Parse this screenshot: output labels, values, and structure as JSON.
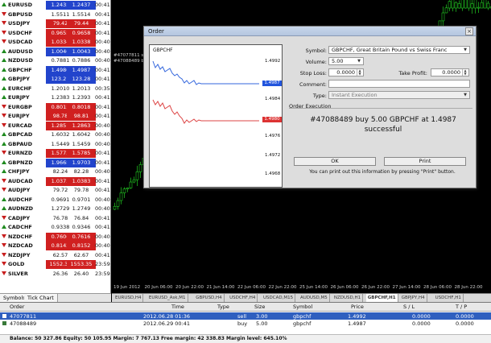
{
  "market_watch": {
    "rows": [
      {
        "symbol": "EURUSD",
        "bid": "1.2435",
        "ask": "1.2437",
        "time": "00:41",
        "dir": "up",
        "style": "blue"
      },
      {
        "symbol": "GBPUSD",
        "bid": "1.5511",
        "ask": "1.5514",
        "time": "00:41",
        "dir": "dn",
        "style": "plain"
      },
      {
        "symbol": "USDJPY",
        "bid": "79.42",
        "ask": "79.44",
        "time": "00:41",
        "dir": "dn",
        "style": "red"
      },
      {
        "symbol": "USDCHF",
        "bid": "0.9655",
        "ask": "0.9658",
        "time": "00:41",
        "dir": "dn",
        "style": "red"
      },
      {
        "symbol": "USDCAD",
        "bid": "1.0334",
        "ask": "1.0338",
        "time": "00:40",
        "dir": "dn",
        "style": "red"
      },
      {
        "symbol": "AUDUSD",
        "bid": "1.0040",
        "ask": "1.0043",
        "time": "00:40",
        "dir": "up",
        "style": "blue"
      },
      {
        "symbol": "NZDUSD",
        "bid": "0.7881",
        "ask": "0.7886",
        "time": "00:40",
        "dir": "up",
        "style": "plain"
      },
      {
        "symbol": "GBPCHF",
        "bid": "1.4980",
        "ask": "1.4987",
        "time": "00:41",
        "dir": "up",
        "style": "blue"
      },
      {
        "symbol": "GBPJPY",
        "bid": "123.21",
        "ask": "123.28",
        "time": "00:41",
        "dir": "up",
        "style": "blue"
      },
      {
        "symbol": "EURCHF",
        "bid": "1.2010",
        "ask": "1.2013",
        "time": "00:35",
        "dir": "up",
        "style": "plain"
      },
      {
        "symbol": "EURJPY",
        "bid": "1.2383",
        "ask": "1.2393",
        "time": "00:41",
        "dir": "up",
        "style": "plain"
      },
      {
        "symbol": "EURGBP",
        "bid": "0.8015",
        "ask": "0.8018",
        "time": "00:41",
        "dir": "dn",
        "style": "red"
      },
      {
        "symbol": "EURJPY",
        "bid": "98.78",
        "ask": "98.81",
        "time": "00:41",
        "dir": "dn",
        "style": "red"
      },
      {
        "symbol": "EURCAD",
        "bid": "1.2851",
        "ask": "1.2863",
        "time": "00:40",
        "dir": "dn",
        "style": "red"
      },
      {
        "symbol": "GBPCAD",
        "bid": "1.6032",
        "ask": "1.6042",
        "time": "00:40",
        "dir": "up",
        "style": "plain"
      },
      {
        "symbol": "GBPAUD",
        "bid": "1.5449",
        "ask": "1.5459",
        "time": "00:40",
        "dir": "up",
        "style": "plain"
      },
      {
        "symbol": "EURNZD",
        "bid": "1.5773",
        "ask": "1.5785",
        "time": "00:41",
        "dir": "dn",
        "style": "red"
      },
      {
        "symbol": "GBPNZD",
        "bid": "1.9668",
        "ask": "1.9703",
        "time": "00:41",
        "dir": "up",
        "style": "blue"
      },
      {
        "symbol": "CHFJPY",
        "bid": "82.24",
        "ask": "82.28",
        "time": "00:40",
        "dir": "up",
        "style": "plain"
      },
      {
        "symbol": "AUDCAD",
        "bid": "1.0373",
        "ask": "1.0383",
        "time": "00:41",
        "dir": "dn",
        "style": "red"
      },
      {
        "symbol": "AUDJPY",
        "bid": "79.72",
        "ask": "79.78",
        "time": "00:41",
        "dir": "dn",
        "style": "plain"
      },
      {
        "symbol": "AUDCHF",
        "bid": "0.9691",
        "ask": "0.9701",
        "time": "00:40",
        "dir": "up",
        "style": "plain"
      },
      {
        "symbol": "AUDNZD",
        "bid": "1.2729",
        "ask": "1.2749",
        "time": "00:40",
        "dir": "up",
        "style": "plain"
      },
      {
        "symbol": "CADJPY",
        "bid": "76.78",
        "ask": "76.84",
        "time": "00:41",
        "dir": "dn",
        "style": "plain"
      },
      {
        "symbol": "CADCHF",
        "bid": "0.9338",
        "ask": "0.9346",
        "time": "00:41",
        "dir": "up",
        "style": "plain"
      },
      {
        "symbol": "NZDCHF",
        "bid": "0.7606",
        "ask": "0.7616",
        "time": "00:40",
        "dir": "dn",
        "style": "red"
      },
      {
        "symbol": "NZDCAD",
        "bid": "0.8142",
        "ask": "0.8152",
        "time": "00:40",
        "dir": "dn",
        "style": "red"
      },
      {
        "symbol": "NZDJPY",
        "bid": "62.57",
        "ask": "62.67",
        "time": "00:41",
        "dir": "dn",
        "style": "plain"
      },
      {
        "symbol": "GOLD",
        "bid": "1552.35",
        "ask": "1553.35",
        "time": "23:59",
        "dir": "dn",
        "style": "red"
      },
      {
        "symbol": "SILVER",
        "bid": "26.36",
        "ask": "26.40",
        "time": "23:59",
        "dir": "dn",
        "style": "plain"
      }
    ],
    "tabs": [
      "Symbols",
      "Tick Chart"
    ]
  },
  "chart": {
    "x_labels": [
      "19 Jun 2012",
      "20 Jun 06:00",
      "20 Jun 22:00",
      "21 Jun 14:00",
      "22 Jun 06:00",
      "22 Jun 22:00",
      "25 Jun 14:00",
      "26 Jun 06:00",
      "26 Jun 22:00",
      "27 Jun 14:00",
      "28 Jun 06:00",
      "28 Jun 22:00"
    ],
    "order_labels": [
      "#47077811 sell",
      "#47088489 buy"
    ],
    "tabs": [
      "EURUSD,H4",
      "EURUSD_Ask,M1",
      "GBPUSD,H4",
      "USDCHF,H4",
      "USDCAD,M15",
      "AUDUSD,M5",
      "NZDUSD,H1",
      "GBPCHF,H1",
      "GBPJPY,H4",
      "USDCHF,H1"
    ],
    "active_tab": 7
  },
  "order_dialog": {
    "title": "Order",
    "close": "×",
    "mini_chart": {
      "symbol": "GBPCHF",
      "price_labels": [
        "1.4992",
        "1.4987",
        "1.4984",
        "1.4980",
        "1.4976",
        "1.4972",
        "1.4968"
      ],
      "ask_badge": "1.4987",
      "bid_badge": "1.4980"
    },
    "symbol_label": "Symbol:",
    "symbol_value": "GBPCHF, Great Britain Pound vs Swiss Franc",
    "volume_label": "Volume:",
    "volume_value": "5.00",
    "stoploss_label": "Stop Loss:",
    "stoploss_value": "0.0000",
    "takeprofit_label": "Take Profit:",
    "takeprofit_value": "0.0000",
    "comment_label": "Comment:",
    "comment_value": "",
    "type_label": "Type:",
    "type_value": "Instant Execution",
    "section_title": "Order Execution",
    "result_line1": "#47088489 buy 5.00 GBPCHF at 1.4987",
    "result_line2": "successful",
    "ok_label": "OK",
    "print_label": "Print",
    "print_hint": "You can print out this information by pressing \"Print\" button."
  },
  "terminal": {
    "headers": {
      "order": "Order",
      "time": "Time",
      "type": "Type",
      "size": "Size",
      "symbol": "Symbol",
      "price": "Price",
      "sl": "S / L",
      "tp": "T / P"
    },
    "rows": [
      {
        "order": "47077811",
        "time": "2012.06.28 01:36",
        "type": "sell",
        "size": "3.00",
        "symbol": "gbpchf",
        "price": "1.4992",
        "sl": "0.0000",
        "tp": "0.0000",
        "selected": true
      },
      {
        "order": "47088489",
        "time": "2012.06.29 00:41",
        "type": "buy",
        "size": "5.00",
        "symbol": "gbpchf",
        "price": "1.4987",
        "sl": "0.0000",
        "tp": "0.0000",
        "selected": false
      }
    ],
    "balance": "Balance: 50 327.86  Equity: 50 105.95  Margin: 7 767.13  Free margin: 42 338.83  Margin level: 645.10%"
  }
}
